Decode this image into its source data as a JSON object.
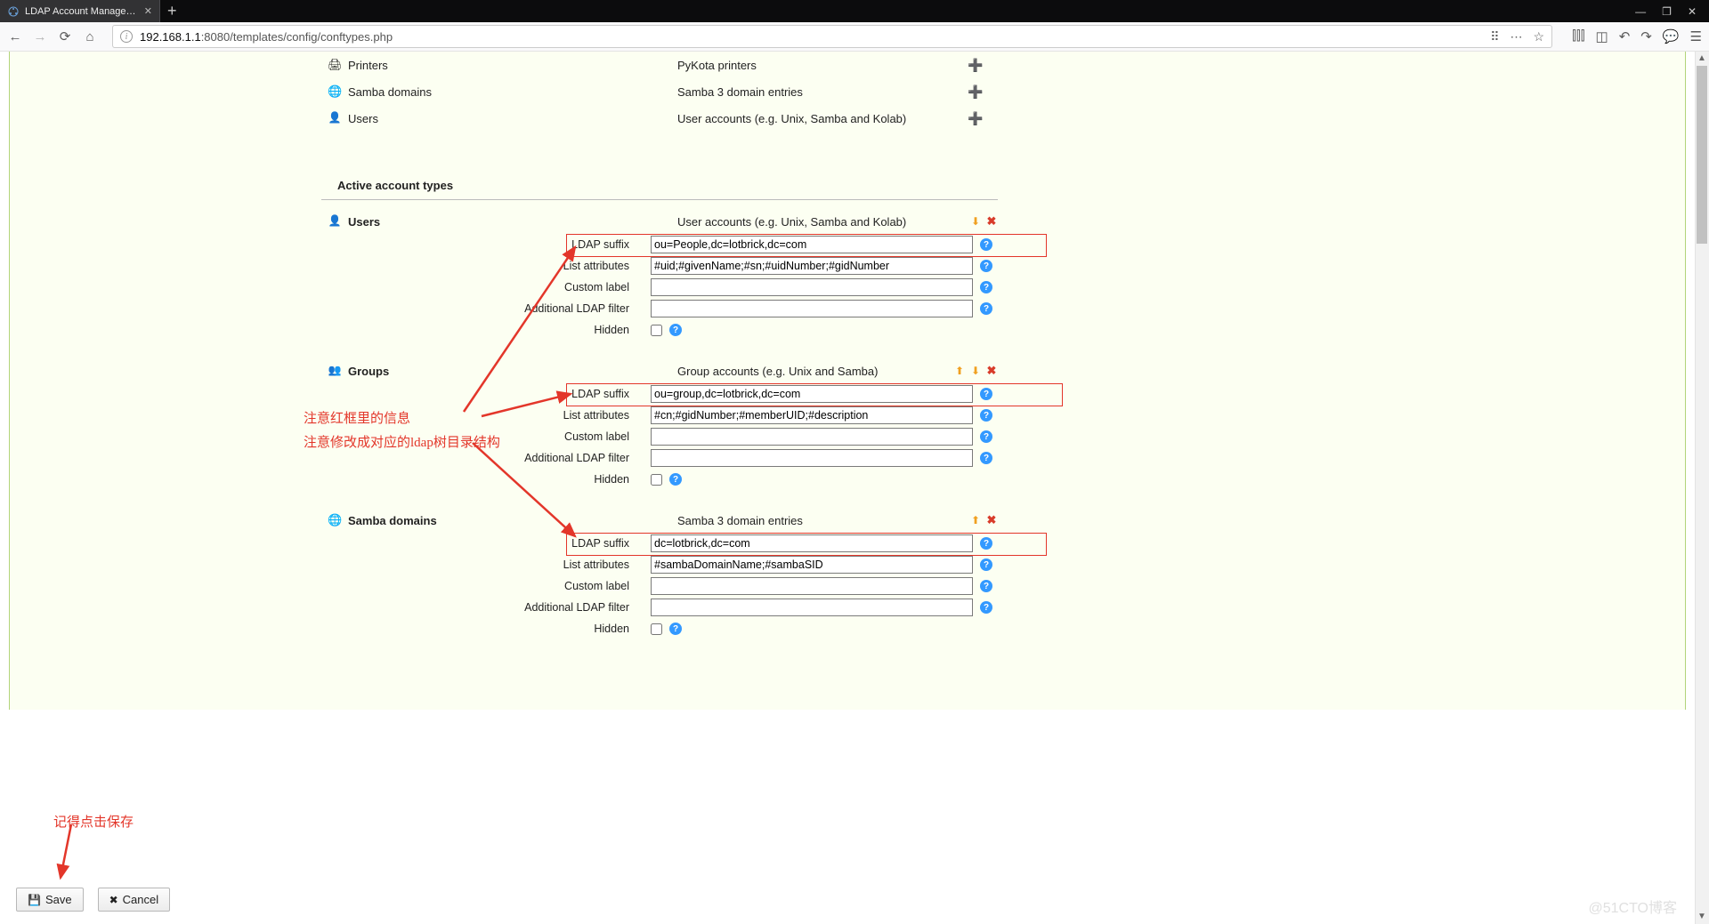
{
  "browser": {
    "tab_title": "LDAP Account Manager Con",
    "url_prefix": "192.168.1.1",
    "url_rest": ":8080/templates/config/conftypes.php",
    "win_min": "—",
    "win_max": "❐",
    "win_close": "✕"
  },
  "available": [
    {
      "icon": "printer",
      "name": "Printers",
      "desc": "PyKota printers"
    },
    {
      "icon": "globe",
      "name": "Samba domains",
      "desc": "Samba 3 domain entries"
    },
    {
      "icon": "user",
      "name": "Users",
      "desc": "User accounts (e.g. Unix, Samba and Kolab)"
    }
  ],
  "section_active": "Active account types",
  "labels": {
    "ldap_suffix": "LDAP suffix",
    "list_attributes": "List attributes",
    "custom_label": "Custom label",
    "additional_filter": "Additional LDAP filter",
    "hidden": "Hidden"
  },
  "accounts": [
    {
      "icon": "user",
      "title": "Users",
      "desc": "User accounts (e.g. Unix, Samba and Kolab)",
      "actions": [
        "down",
        "remove"
      ],
      "ldap_suffix": "ou=People,dc=lotbrick,dc=com",
      "list_attrs": "#uid;#givenName;#sn;#uidNumber;#gidNumber",
      "custom_label": "",
      "add_filter": ""
    },
    {
      "icon": "group",
      "title": "Groups",
      "desc": "Group accounts (e.g. Unix and Samba)",
      "actions": [
        "up",
        "down",
        "remove"
      ],
      "ldap_suffix": "ou=group,dc=lotbrick,dc=com",
      "list_attrs": "#cn;#gidNumber;#memberUID;#description",
      "custom_label": "",
      "add_filter": ""
    },
    {
      "icon": "globe",
      "title": "Samba domains",
      "desc": "Samba 3 domain entries",
      "actions": [
        "up",
        "remove"
      ],
      "ldap_suffix": "dc=lotbrick,dc=com",
      "list_attrs": "#sambaDomainName;#sambaSID",
      "custom_label": "",
      "add_filter": ""
    }
  ],
  "annotations": {
    "note1": "注意红框里的信息",
    "note2": "注意修改成对应的ldap树目录结构",
    "save_hint": "记得点击保存"
  },
  "buttons": {
    "save": "Save",
    "cancel": "Cancel"
  },
  "watermark": "@51CTO博客"
}
